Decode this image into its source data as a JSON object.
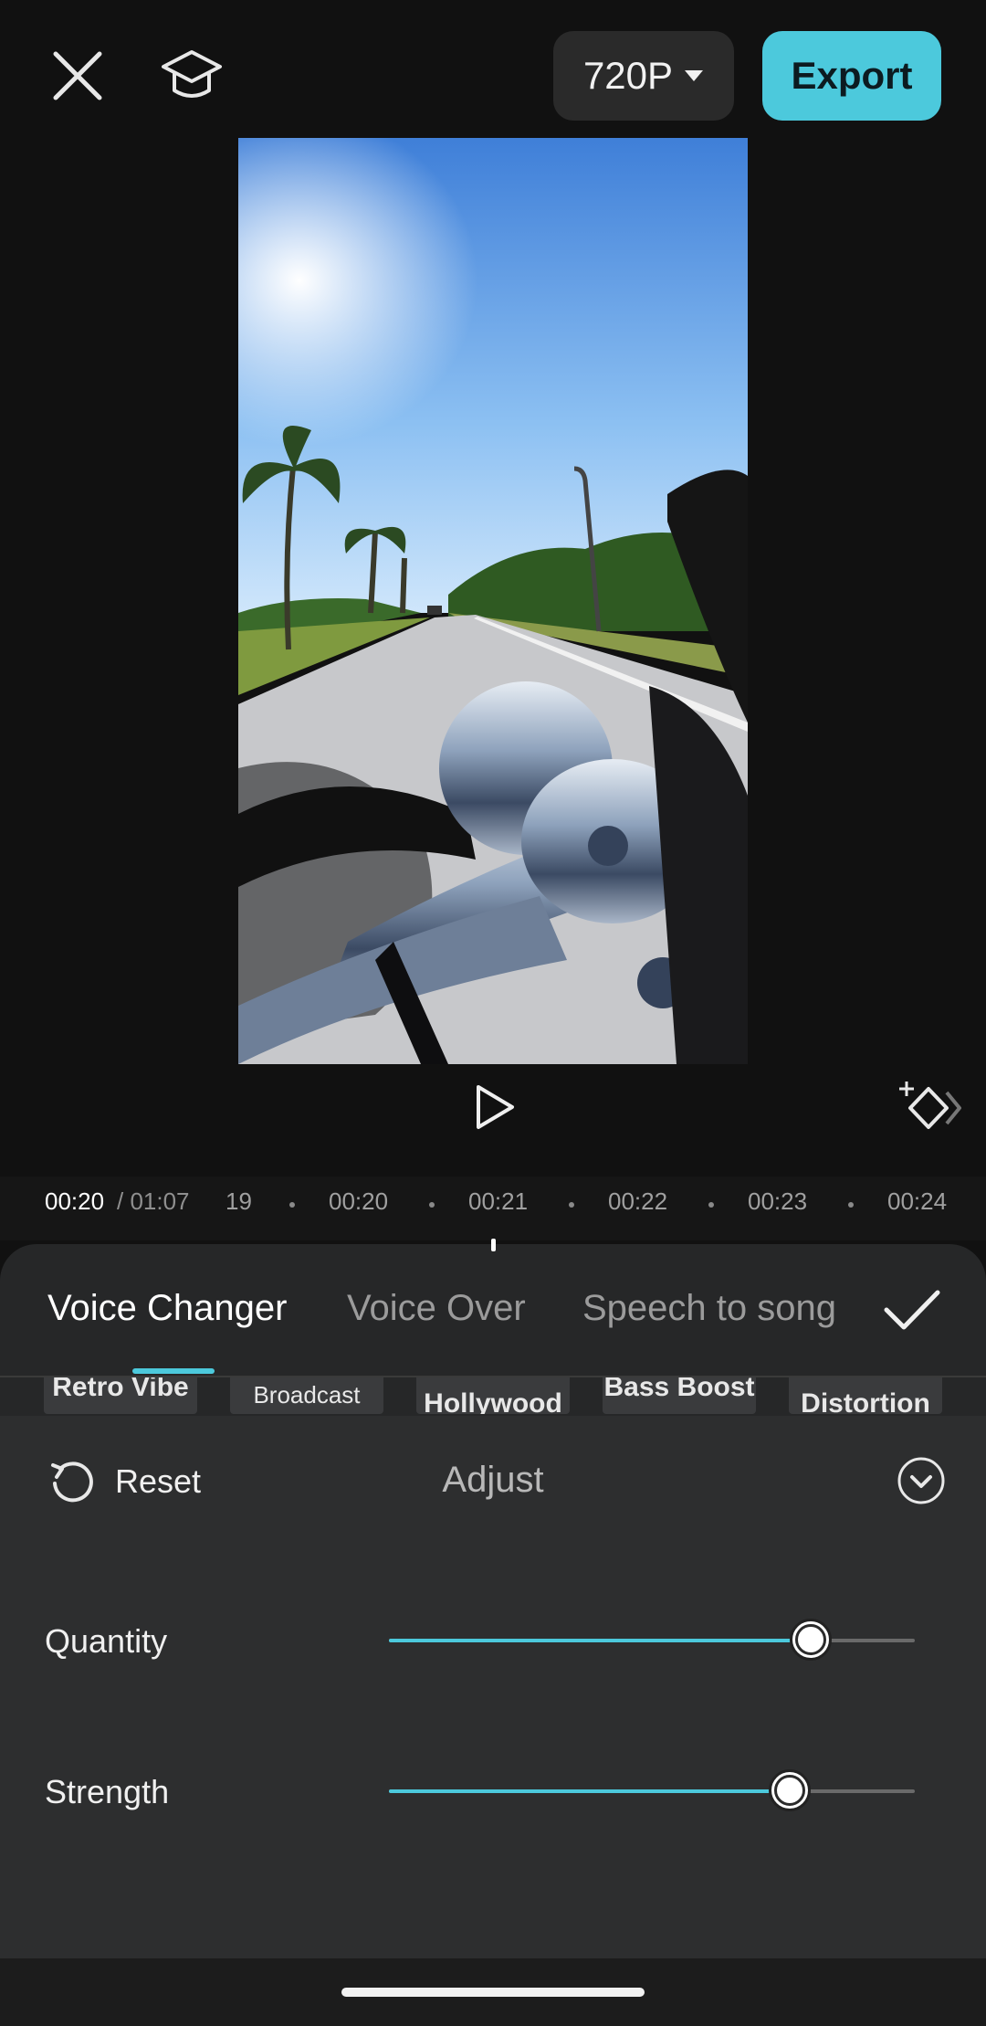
{
  "header": {
    "resolution_label": "720P",
    "export_label": "Export"
  },
  "timeline": {
    "current_time": "00:20",
    "total_time": "/ 01:07",
    "ticks": [
      "19",
      "00:20",
      "00:21",
      "00:22",
      "00:23",
      "00:24"
    ]
  },
  "tabs": {
    "voice_changer": "Voice Changer",
    "voice_over": "Voice Over",
    "speech_to_song": "Speech to song"
  },
  "effects": [
    "Retro Vibe",
    "Broadcast",
    "Hollywood",
    "Bass Boost",
    "Distortion"
  ],
  "adjust": {
    "reset_label": "Reset",
    "title": "Adjust",
    "sliders": [
      {
        "label": "Quantity",
        "value_fraction": 0.8
      },
      {
        "label": "Strength",
        "value_fraction": 0.76
      }
    ]
  },
  "colors": {
    "accent": "#4cc9dc",
    "background": "#111111",
    "panel": "#262728"
  },
  "icons": [
    "close-icon",
    "graduation-cap-icon",
    "caret-down-icon",
    "play-icon",
    "keyframe-icon",
    "checkmark-icon",
    "reset-icon",
    "chevron-down-icon"
  ]
}
